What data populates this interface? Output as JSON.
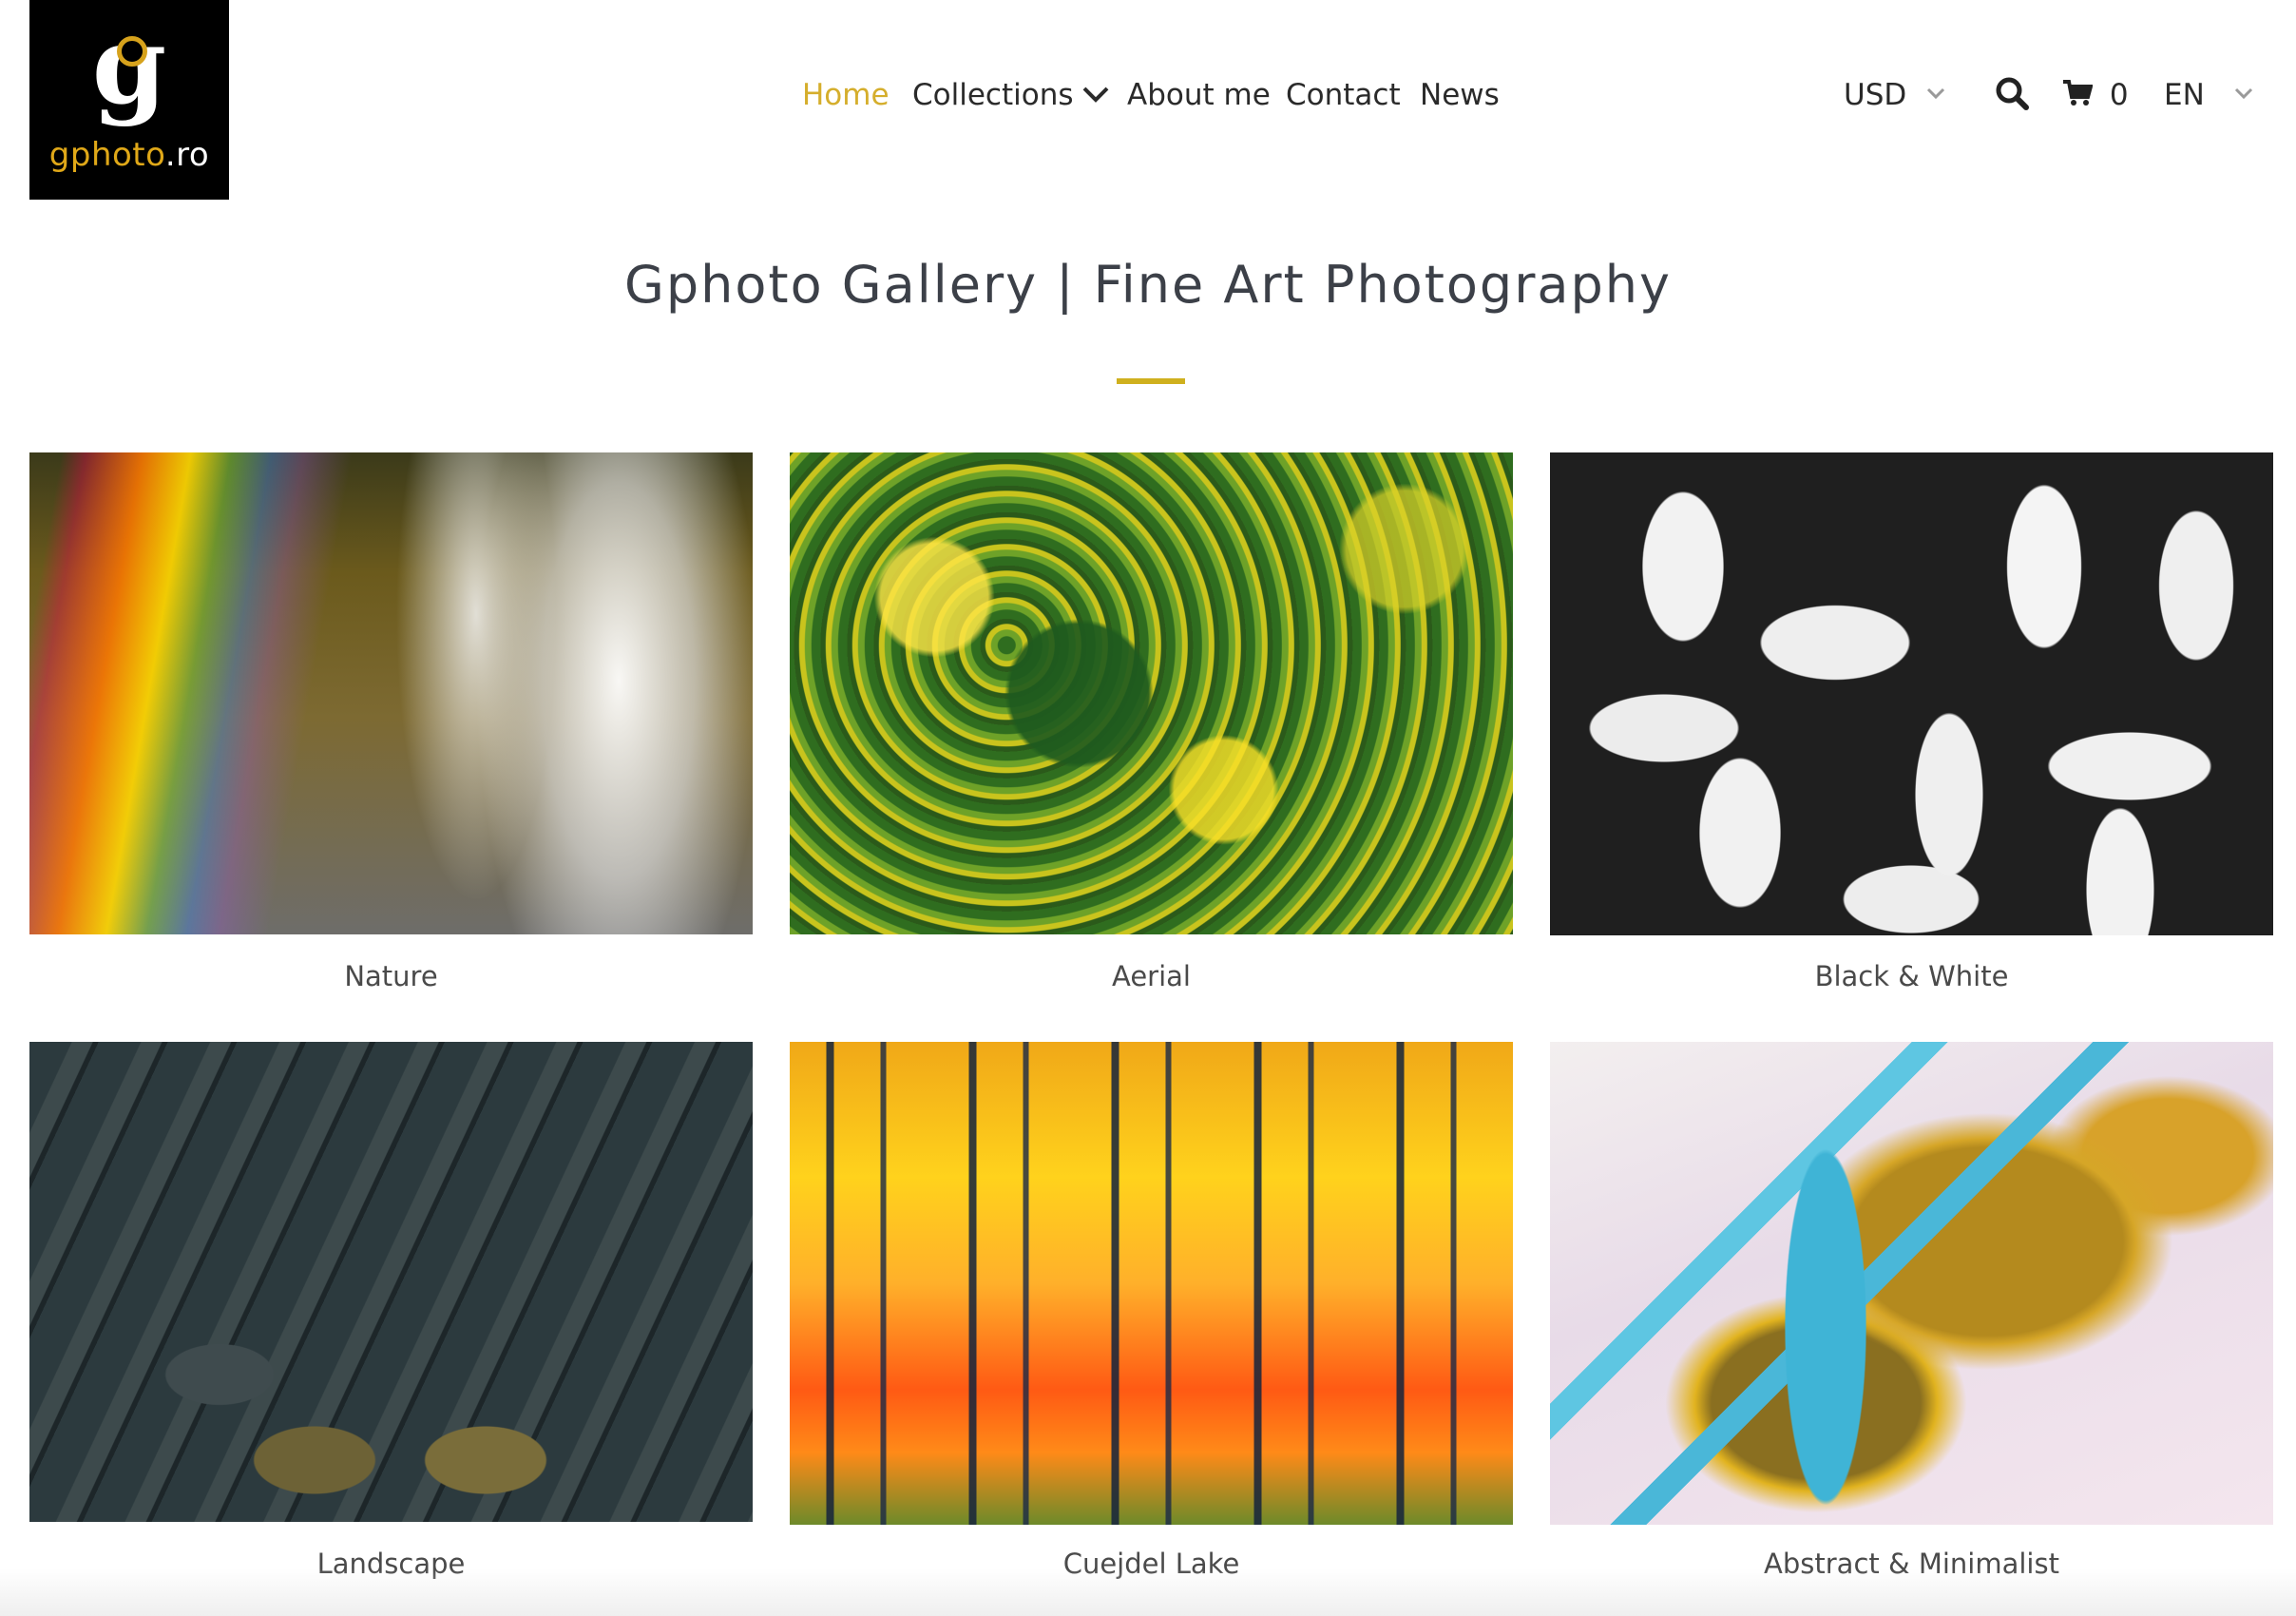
{
  "logo": {
    "glyph": "g",
    "text_part1": "gphoto",
    "text_part2": ".ro"
  },
  "nav": {
    "items": [
      {
        "label": "Home",
        "active": true
      },
      {
        "label": "Collections",
        "active": false
      },
      {
        "label": "About me",
        "active": false
      },
      {
        "label": "Contact",
        "active": false
      },
      {
        "label": "News",
        "active": false
      }
    ]
  },
  "utility": {
    "currency": "USD",
    "cart_count": "0",
    "language": "EN"
  },
  "page": {
    "title": "Gphoto Gallery | Fine Art Photography"
  },
  "collections": [
    {
      "label": "Nature"
    },
    {
      "label": "Aerial"
    },
    {
      "label": "Black & White"
    },
    {
      "label": "Landscape"
    },
    {
      "label": "Cuejdel Lake"
    },
    {
      "label": "Abstract & Minimalist"
    }
  ],
  "colors": {
    "accent": "#d5ae2c",
    "text": "#2a2a2a",
    "logo_bg": "#000000"
  },
  "icons": [
    "chevron-down-icon",
    "search-icon",
    "cart-icon"
  ]
}
